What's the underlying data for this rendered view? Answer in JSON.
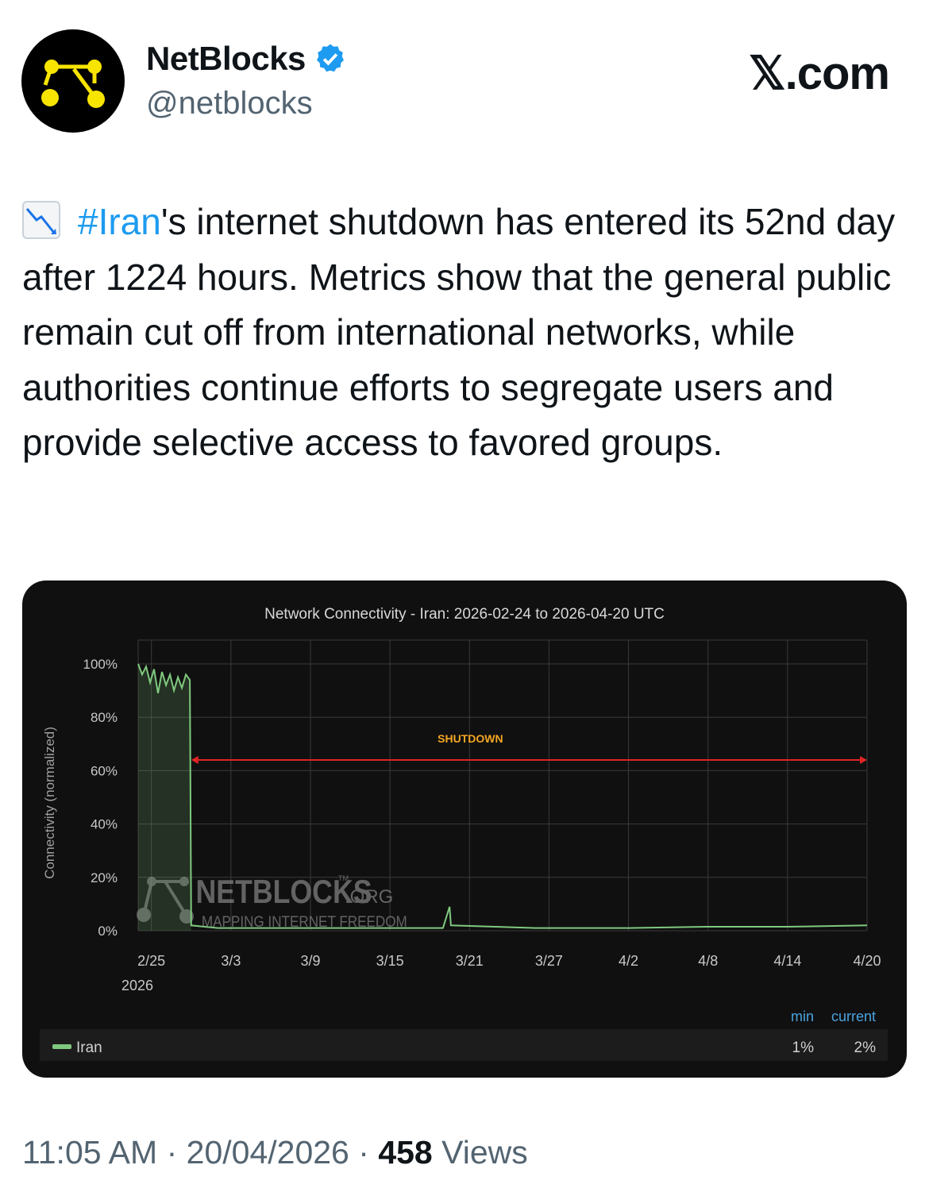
{
  "account": {
    "display_name": "NetBlocks",
    "handle": "@netblocks",
    "verified": true,
    "avatar_icon": "netblocks-logo-icon",
    "verified_icon": "verified-badge-icon"
  },
  "brand": {
    "label": "𝕏.com"
  },
  "tweet": {
    "emoji": "chart-decreasing-icon",
    "hashtag": "#Iran",
    "text": "'s internet shutdown has entered its 52nd day after 1224 hours. Metrics show that the general public remain cut off from international networks, while authorities continue efforts to segregate users and provide selective access to favored groups."
  },
  "chart_data": {
    "type": "line",
    "title": "Network Connectivity - Iran: 2026-02-24 to 2026-04-20 UTC",
    "ylabel": "Connectivity (normalized)",
    "xlabel": "",
    "ylim": [
      0,
      100
    ],
    "x_ticks": [
      "2/25",
      "3/3",
      "3/9",
      "3/15",
      "3/21",
      "3/27",
      "4/2",
      "4/8",
      "4/14",
      "4/20"
    ],
    "x_tick_sublabel": "2026",
    "y_ticks": [
      "0%",
      "20%",
      "40%",
      "60%",
      "80%",
      "100%"
    ],
    "grid": true,
    "annotation": {
      "label": "SHUTDOWN",
      "from": "2/28",
      "to": "4/20",
      "color": "#e02424",
      "label_color": "#f5a623"
    },
    "watermark": {
      "title": "NETBLOCKS",
      "suffix": ".ORG",
      "tm": "TM",
      "subtitle": "MAPPING INTERNET FREEDOM"
    },
    "series": [
      {
        "name": "Iran",
        "color": "#7fc97f",
        "points": [
          [
            "2/24",
            100
          ],
          [
            "2/24.3",
            96
          ],
          [
            "2/24.6",
            99
          ],
          [
            "2/24.9",
            93
          ],
          [
            "2/25.2",
            98
          ],
          [
            "2/25.5",
            89
          ],
          [
            "2/25.8",
            97
          ],
          [
            "2/26.1",
            92
          ],
          [
            "2/26.4",
            96
          ],
          [
            "2/26.7",
            90
          ],
          [
            "2/27.0",
            95
          ],
          [
            "2/27.3",
            91
          ],
          [
            "2/27.6",
            96
          ],
          [
            "2/27.9",
            94
          ],
          [
            "2/28.0",
            2
          ],
          [
            "3/2",
            1
          ],
          [
            "3/8",
            1
          ],
          [
            "3/14",
            1
          ],
          [
            "3/19",
            1
          ],
          [
            "3/19.5",
            9
          ],
          [
            "3/19.6",
            2
          ],
          [
            "3/26",
            1
          ],
          [
            "4/2",
            1
          ],
          [
            "4/8",
            1.5
          ],
          [
            "4/14",
            1.5
          ],
          [
            "4/20",
            2
          ]
        ]
      }
    ],
    "legend": {
      "placement": "bottom",
      "headers": [
        "min",
        "current"
      ],
      "values": [
        "1%",
        "2%"
      ]
    }
  },
  "meta": {
    "time": "11:05 AM",
    "separator": "·",
    "date": "20/04/2026",
    "views_count": "458",
    "views_label": "Views"
  }
}
